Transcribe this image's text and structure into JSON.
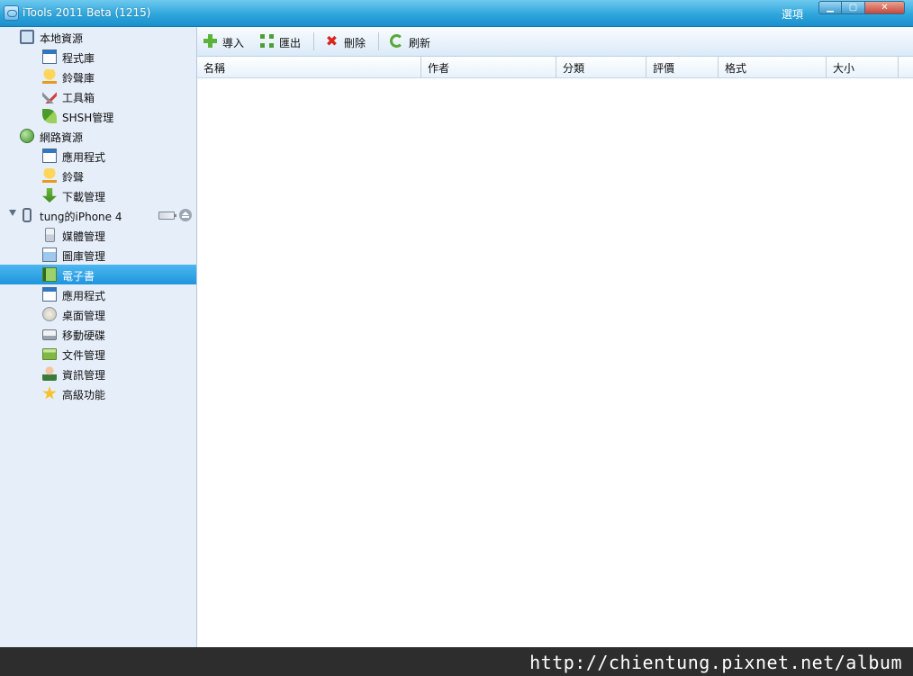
{
  "window": {
    "title": "iTools 2011 Beta (1215)",
    "options_label": "選項",
    "minimize_glyph": "▁",
    "maximize_glyph": "▢",
    "close_glyph": "✕"
  },
  "sidebar": {
    "groups": [
      {
        "label": "本地資源",
        "icon": "monitor-icon",
        "items": [
          {
            "label": "程式庫",
            "icon": "window-icon"
          },
          {
            "label": "鈴聲庫",
            "icon": "bell-icon"
          },
          {
            "label": "工具箱",
            "icon": "tools-icon"
          },
          {
            "label": "SHSH管理",
            "icon": "leaf-icon"
          }
        ]
      },
      {
        "label": "網路資源",
        "icon": "globe-icon",
        "items": [
          {
            "label": "應用程式",
            "icon": "window-icon"
          },
          {
            "label": "鈴聲",
            "icon": "bell-icon"
          },
          {
            "label": "下載管理",
            "icon": "download-arrow-icon"
          }
        ]
      },
      {
        "label": "tung的iPhone 4",
        "icon": "phone-icon",
        "items": [
          {
            "label": "媒體管理",
            "icon": "ipod-icon"
          },
          {
            "label": "圖庫管理",
            "icon": "photos-icon"
          },
          {
            "label": "電子書",
            "icon": "book-icon",
            "selected": true
          },
          {
            "label": "應用程式",
            "icon": "window-icon"
          },
          {
            "label": "桌面管理",
            "icon": "desktop-icon"
          },
          {
            "label": "移動硬碟",
            "icon": "drive-icon"
          },
          {
            "label": "文件管理",
            "icon": "folder-icon"
          },
          {
            "label": "資訊管理",
            "icon": "person-icon"
          },
          {
            "label": "高級功能",
            "icon": "star-icon"
          }
        ]
      }
    ]
  },
  "toolbar": {
    "import_label": "導入",
    "export_label": "匯出",
    "delete_label": "刪除",
    "refresh_label": "刷新"
  },
  "table": {
    "columns": [
      "名稱",
      "作者",
      "分類",
      "評價",
      "格式",
      "大小"
    ],
    "rows": []
  },
  "watermark": "http://chientung.pixnet.net/album"
}
